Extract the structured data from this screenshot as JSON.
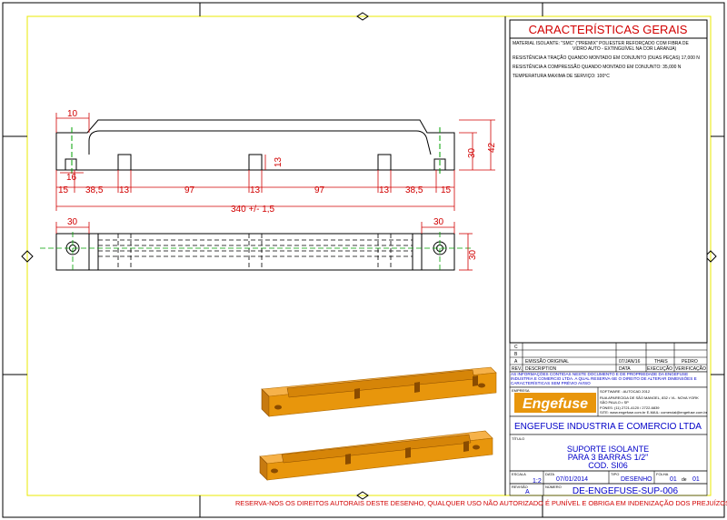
{
  "sheet": {
    "footer_note": "RESERVA-NOS OS DIREITOS AUTORAIS DESTE DESENHO, QUALQUER USO NÃO AUTORIZADO É PUNÍVEL E OBRIGA EM INDENIZAÇÃO DOS PREJUÍZOS."
  },
  "characteristics": {
    "title": "CARACTERÍSTICAS GERAIS",
    "lines": [
      "MATERIAL ISOLANTE: \"SMC\" (\"PREMIX\" POLIESTER REFORÇADO COM FIBRA DE",
      "VIDRO AUTO - EXTINGUÍVEL NA COR LARANJA)",
      "RESISTÊNCIA A TRAÇÃO QUANDO MONTADO EM CONJUNTO (DUAS PEÇAS) 17,000 N",
      "RESISTÊNCIA A COMPRESSÃO QUANDO MONTADO EM CONJUNTO: 35,000 N",
      "TEMPERATURA MAXIMA DE SERVIÇO: 100°C"
    ]
  },
  "dimensions": {
    "top": [
      "10",
      "16",
      "13",
      "30",
      "42"
    ],
    "row": [
      "15",
      "38,5",
      "13",
      "97",
      "13",
      "97",
      "13",
      "38,5",
      "15"
    ],
    "total": "340 +/- 1,5",
    "bottom_left": "30",
    "bottom_right": "30",
    "bottom_side": "30"
  },
  "revisions": {
    "rows": [
      {
        "rev": "C",
        "desc": "",
        "date": "",
        "exec": "",
        "verif": ""
      },
      {
        "rev": "B",
        "desc": "",
        "date": "",
        "exec": "",
        "verif": ""
      },
      {
        "rev": "A",
        "desc": "EMISSÃO ORIGINAL",
        "date": "07/JAN/16",
        "exec": "THAIS",
        "verif": "PEDRO"
      }
    ],
    "header": {
      "rev": "REV.",
      "desc": "DESCRIPTION",
      "date": "DATA",
      "exec": "EXECUÇÃO",
      "verif": "VERIFICAÇÃO"
    }
  },
  "notice": "AS INFORMAÇÕES CONTIDAS NESTE DOCUMENTO E DE PROPRIEDADE DA ENGEFUSE INDUSTRIA E COMERCIO LTDA. A QUAL RESERVA-SE O DIREITO DE ALTERAR DIMENSÕES E CARACTERÍSTICAS SEM PRÉVIO AVISO",
  "company": {
    "label": "EMPRESA",
    "logo": "Engefuse",
    "software": "SOFTWARE : AUTOCAD 2012",
    "address1": "RUA APARECIDA DE SÃO MANOEL, 832 • VL. NOVA YORK",
    "address2": "SÃO PAULO • SP",
    "phone": "FONES: (11) 2721-4120 / 2722-6839",
    "site": "SITE: www.engefuse.com.br   E-MAIL: comercial@engefuse.com.br",
    "name": "ENGEFUSE INDUSTRIA E COMERCIO LTDA"
  },
  "title_block": {
    "label": "TÍTULO",
    "line1": "SUPORTE ISOLANTE",
    "line2": "PARA 3 BARRAS 1/2\"",
    "line3": "COD. SI06",
    "scale_label": "ESCALA",
    "scale": "1:2",
    "date_label": "DATA",
    "date": "07/01/2014",
    "type_label": "TIPO",
    "type": "DESENHO",
    "sheet_label": "FOLHA",
    "sheet_num": "01",
    "sheet_of": "de",
    "sheet_total": "01",
    "rev_label": "REVISÃO",
    "rev": "A",
    "number_label": "NÚMERO",
    "number": "DE-ENGEFUSE-SUP-006"
  },
  "colors": {
    "frame": "#000000",
    "green": "#00a000",
    "red": "#d10000",
    "yellow": "#ffff00",
    "blue": "#0000c8",
    "orange": "#e8960c"
  }
}
